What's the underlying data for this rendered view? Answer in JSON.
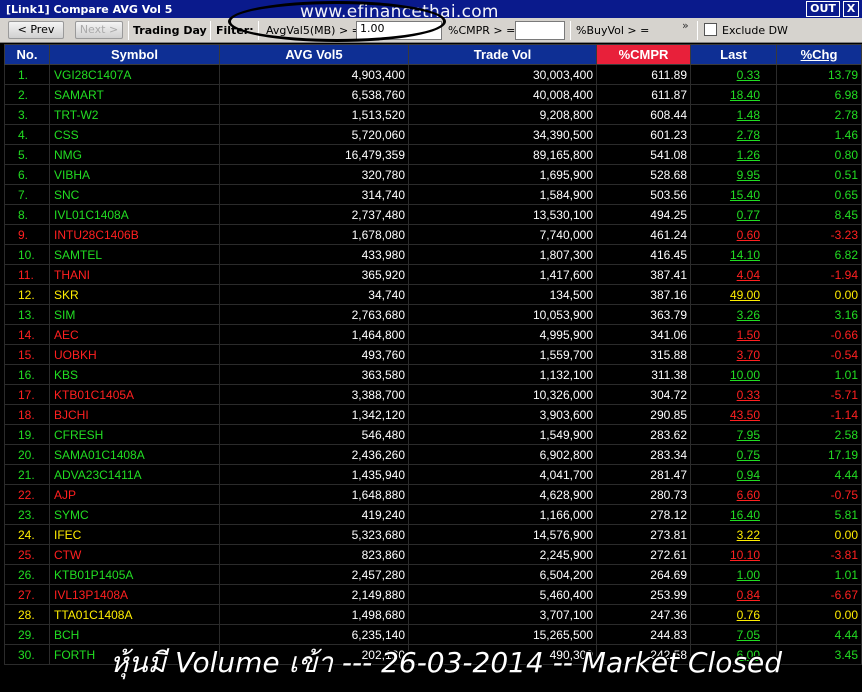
{
  "window": {
    "title": "[Link1] Compare AVG Vol 5",
    "out_label": "OUT",
    "close_label": "X"
  },
  "toolbar": {
    "prev_label": "< Prev",
    "next_label": "Next >",
    "trading_day_label": "Trading Day",
    "filter_label": "Filter:",
    "avgvol_label": "AvgVal5(MB) > =",
    "avgvol_value": "1.00",
    "cmpr_label": "%CMPR > =",
    "cmpr_value": "",
    "buyvol_label": "%BuyVol > =",
    "more_icon": "double-chevron",
    "exclude_dw_label": "Exclude DW",
    "exclude_dw_checked": false
  },
  "watermark": "www.efinancethai.com",
  "table": {
    "columns": [
      "No.",
      "Symbol",
      "AVG Vol5",
      "Trade Vol",
      "%CMPR",
      "Last",
      "%Chg"
    ],
    "sorted_column": "%CMPR",
    "colors": {
      "up": "#22dd22",
      "down": "#ff2020",
      "flat": "#ffee00",
      "header": "#0e2f94",
      "sorted_header": "#e8203a"
    },
    "rows": [
      {
        "no": "1.",
        "symbol": "VGI28C1407A",
        "avg_vol5": "4,903,400",
        "trade_vol": "30,003,400",
        "cmpr": "611.89",
        "last": "0.33",
        "chg": "13.79",
        "dir": "up"
      },
      {
        "no": "2.",
        "symbol": "SAMART",
        "avg_vol5": "6,538,760",
        "trade_vol": "40,008,400",
        "cmpr": "611.87",
        "last": "18.40",
        "chg": "6.98",
        "dir": "up"
      },
      {
        "no": "3.",
        "symbol": "TRT-W2",
        "avg_vol5": "1,513,520",
        "trade_vol": "9,208,800",
        "cmpr": "608.44",
        "last": "1.48",
        "chg": "2.78",
        "dir": "up"
      },
      {
        "no": "4.",
        "symbol": "CSS",
        "avg_vol5": "5,720,060",
        "trade_vol": "34,390,500",
        "cmpr": "601.23",
        "last": "2.78",
        "chg": "1.46",
        "dir": "up"
      },
      {
        "no": "5.",
        "symbol": "NMG",
        "avg_vol5": "16,479,359",
        "trade_vol": "89,165,800",
        "cmpr": "541.08",
        "last": "1.26",
        "chg": "0.80",
        "dir": "up"
      },
      {
        "no": "6.",
        "symbol": "VIBHA",
        "avg_vol5": "320,780",
        "trade_vol": "1,695,900",
        "cmpr": "528.68",
        "last": "9.95",
        "chg": "0.51",
        "dir": "up"
      },
      {
        "no": "7.",
        "symbol": "SNC",
        "avg_vol5": "314,740",
        "trade_vol": "1,584,900",
        "cmpr": "503.56",
        "last": "15.40",
        "chg": "0.65",
        "dir": "up"
      },
      {
        "no": "8.",
        "symbol": "IVL01C1408A",
        "avg_vol5": "2,737,480",
        "trade_vol": "13,530,100",
        "cmpr": "494.25",
        "last": "0.77",
        "chg": "8.45",
        "dir": "up"
      },
      {
        "no": "9.",
        "symbol": "INTU28C1406B",
        "avg_vol5": "1,678,080",
        "trade_vol": "7,740,000",
        "cmpr": "461.24",
        "last": "0.60",
        "chg": "-3.23",
        "dir": "down"
      },
      {
        "no": "10.",
        "symbol": "SAMTEL",
        "avg_vol5": "433,980",
        "trade_vol": "1,807,300",
        "cmpr": "416.45",
        "last": "14.10",
        "chg": "6.82",
        "dir": "up"
      },
      {
        "no": "11.",
        "symbol": "THANI",
        "avg_vol5": "365,920",
        "trade_vol": "1,417,600",
        "cmpr": "387.41",
        "last": "4.04",
        "chg": "-1.94",
        "dir": "down"
      },
      {
        "no": "12.",
        "symbol": "SKR",
        "avg_vol5": "34,740",
        "trade_vol": "134,500",
        "cmpr": "387.16",
        "last": "49.00",
        "chg": "0.00",
        "dir": "flat"
      },
      {
        "no": "13.",
        "symbol": "SIM",
        "avg_vol5": "2,763,680",
        "trade_vol": "10,053,900",
        "cmpr": "363.79",
        "last": "3.26",
        "chg": "3.16",
        "dir": "up"
      },
      {
        "no": "14.",
        "symbol": "AEC",
        "avg_vol5": "1,464,800",
        "trade_vol": "4,995,900",
        "cmpr": "341.06",
        "last": "1.50",
        "chg": "-0.66",
        "dir": "down"
      },
      {
        "no": "15.",
        "symbol": "UOBKH",
        "avg_vol5": "493,760",
        "trade_vol": "1,559,700",
        "cmpr": "315.88",
        "last": "3.70",
        "chg": "-0.54",
        "dir": "down"
      },
      {
        "no": "16.",
        "symbol": "KBS",
        "avg_vol5": "363,580",
        "trade_vol": "1,132,100",
        "cmpr": "311.38",
        "last": "10.00",
        "chg": "1.01",
        "dir": "up"
      },
      {
        "no": "17.",
        "symbol": "KTB01C1405A",
        "avg_vol5": "3,388,700",
        "trade_vol": "10,326,000",
        "cmpr": "304.72",
        "last": "0.33",
        "chg": "-5.71",
        "dir": "down"
      },
      {
        "no": "18.",
        "symbol": "BJCHI",
        "avg_vol5": "1,342,120",
        "trade_vol": "3,903,600",
        "cmpr": "290.85",
        "last": "43.50",
        "chg": "-1.14",
        "dir": "down"
      },
      {
        "no": "19.",
        "symbol": "CFRESH",
        "avg_vol5": "546,480",
        "trade_vol": "1,549,900",
        "cmpr": "283.62",
        "last": "7.95",
        "chg": "2.58",
        "dir": "up"
      },
      {
        "no": "20.",
        "symbol": "SAMA01C1408A",
        "avg_vol5": "2,436,260",
        "trade_vol": "6,902,800",
        "cmpr": "283.34",
        "last": "0.75",
        "chg": "17.19",
        "dir": "up"
      },
      {
        "no": "21.",
        "symbol": "ADVA23C1411A",
        "avg_vol5": "1,435,940",
        "trade_vol": "4,041,700",
        "cmpr": "281.47",
        "last": "0.94",
        "chg": "4.44",
        "dir": "up"
      },
      {
        "no": "22.",
        "symbol": "AJP",
        "avg_vol5": "1,648,880",
        "trade_vol": "4,628,900",
        "cmpr": "280.73",
        "last": "6.60",
        "chg": "-0.75",
        "dir": "down"
      },
      {
        "no": "23.",
        "symbol": "SYMC",
        "avg_vol5": "419,240",
        "trade_vol": "1,166,000",
        "cmpr": "278.12",
        "last": "16.40",
        "chg": "5.81",
        "dir": "up"
      },
      {
        "no": "24.",
        "symbol": "IFEC",
        "avg_vol5": "5,323,680",
        "trade_vol": "14,576,900",
        "cmpr": "273.81",
        "last": "3.22",
        "chg": "0.00",
        "dir": "flat"
      },
      {
        "no": "25.",
        "symbol": "CTW",
        "avg_vol5": "823,860",
        "trade_vol": "2,245,900",
        "cmpr": "272.61",
        "last": "10.10",
        "chg": "-3.81",
        "dir": "down"
      },
      {
        "no": "26.",
        "symbol": "KTB01P1405A",
        "avg_vol5": "2,457,280",
        "trade_vol": "6,504,200",
        "cmpr": "264.69",
        "last": "1.00",
        "chg": "1.01",
        "dir": "up"
      },
      {
        "no": "27.",
        "symbol": "IVL13P1408A",
        "avg_vol5": "2,149,880",
        "trade_vol": "5,460,400",
        "cmpr": "253.99",
        "last": "0.84",
        "chg": "-6.67",
        "dir": "down"
      },
      {
        "no": "28.",
        "symbol": "TTA01C1408A",
        "avg_vol5": "1,498,680",
        "trade_vol": "3,707,100",
        "cmpr": "247.36",
        "last": "0.76",
        "chg": "0.00",
        "dir": "flat"
      },
      {
        "no": "29.",
        "symbol": "BCH",
        "avg_vol5": "6,235,140",
        "trade_vol": "15,265,500",
        "cmpr": "244.83",
        "last": "7.05",
        "chg": "4.44",
        "dir": "up"
      },
      {
        "no": "30.",
        "symbol": "FORTH",
        "avg_vol5": "202,120",
        "trade_vol": "490,300",
        "cmpr": "242.58",
        "last": "6.00",
        "chg": "3.45",
        "dir": "up"
      }
    ]
  },
  "caption": "หุ้นมี Volume เข้า --- 26-03-2014 -- Market Closed"
}
